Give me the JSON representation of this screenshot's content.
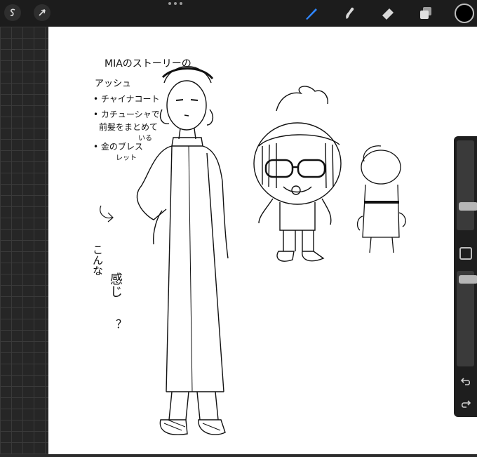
{
  "app": {
    "toolbar_left": [
      {
        "name": "gallery-icon"
      },
      {
        "name": "selection-icon"
      }
    ],
    "toolbar_right": [
      {
        "name": "brush-icon",
        "active": true,
        "color": "#2f86ff"
      },
      {
        "name": "smudge-icon"
      },
      {
        "name": "eraser-icon"
      },
      {
        "name": "layers-icon"
      },
      {
        "name": "color-icon",
        "value": "#000000"
      }
    ],
    "sidebar": {
      "brush_size_level": 0.56,
      "opacity_level": 0.04,
      "modify_button": "modify-icon",
      "undo": "undo-icon",
      "redo": "redo-icon"
    }
  },
  "canvas": {
    "notes": {
      "title": "MIAのストーリーの",
      "line2": "アッシュ",
      "item1": "• チャイナコート",
      "item2": "• カチューシャで",
      "item2b": "前髪をまとめて",
      "item2c": "いる",
      "item3": "• 金のブレス",
      "item3b": "レット",
      "side1": "こんな",
      "side2": "感じ",
      "side3": "？"
    }
  }
}
